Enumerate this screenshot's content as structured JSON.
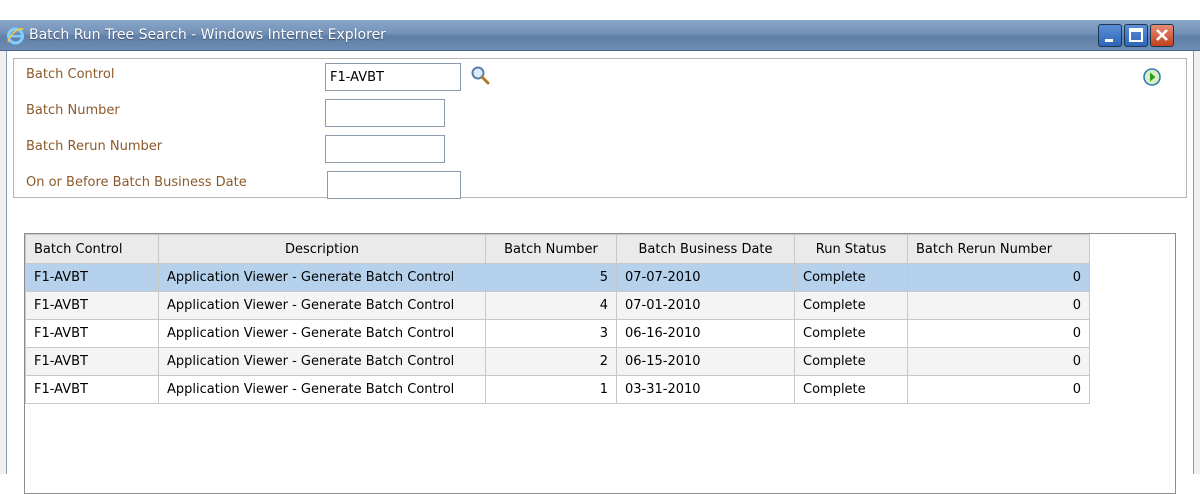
{
  "window": {
    "title": "Batch Run Tree Search - Windows Internet Explorer"
  },
  "search": {
    "fields": [
      {
        "label": "Batch Control",
        "value": "F1-AVBT"
      },
      {
        "label": "Batch Number",
        "value": ""
      },
      {
        "label": "Batch Rerun Number",
        "value": ""
      },
      {
        "label": "On or Before Batch Business Date",
        "value": ""
      }
    ]
  },
  "table": {
    "headers": [
      "Batch Control",
      "Description",
      "Batch Number",
      "Batch Business Date",
      "Run Status",
      "Batch Rerun Number"
    ],
    "rows": [
      {
        "batch_control": "F1-AVBT",
        "description": "Application Viewer - Generate Batch Control",
        "batch_number": "5",
        "business_date": "07-07-2010",
        "run_status": "Complete",
        "rerun_number": "0"
      },
      {
        "batch_control": "F1-AVBT",
        "description": "Application Viewer - Generate Batch Control",
        "batch_number": "4",
        "business_date": "07-01-2010",
        "run_status": "Complete",
        "rerun_number": "0"
      },
      {
        "batch_control": "F1-AVBT",
        "description": "Application Viewer - Generate Batch Control",
        "batch_number": "3",
        "business_date": "06-16-2010",
        "run_status": "Complete",
        "rerun_number": "0"
      },
      {
        "batch_control": "F1-AVBT",
        "description": "Application Viewer - Generate Batch Control",
        "batch_number": "2",
        "business_date": "06-15-2010",
        "run_status": "Complete",
        "rerun_number": "0"
      },
      {
        "batch_control": "F1-AVBT",
        "description": "Application Viewer - Generate Batch Control",
        "batch_number": "1",
        "business_date": "03-31-2010",
        "run_status": "Complete",
        "rerun_number": "0"
      }
    ],
    "selected_row": 0
  },
  "icons": {
    "app": "ie-logo-icon",
    "lookup": "search-magnifier-icon",
    "go": "go-arrow-icon"
  },
  "colors": {
    "field_label": "#8b5a2b",
    "selected_row": "#b5d1ec",
    "titlebar": "#7391b7"
  }
}
